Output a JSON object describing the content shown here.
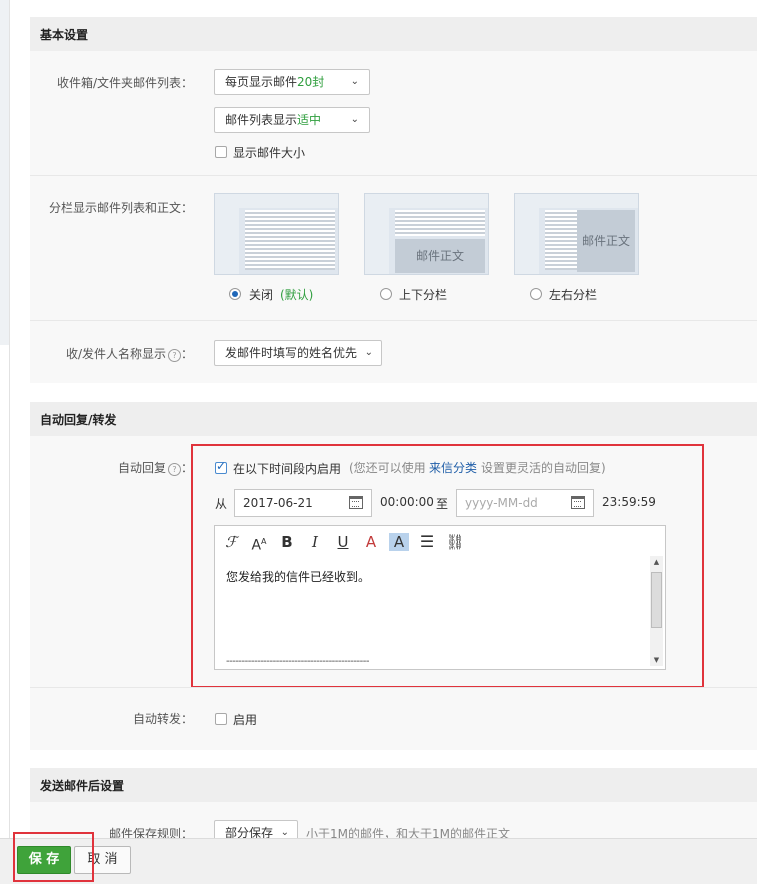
{
  "sections": {
    "basic": "基本设置",
    "auto_reply": "自动回复/转发",
    "after_send": "发送邮件后设置"
  },
  "basic": {
    "mail_list_label": "收件箱/文件夹邮件列表：",
    "per_page_prefix": "每页显示邮件",
    "per_page_value": "20封",
    "list_display_prefix": "邮件列表显示",
    "list_display_value": "适中",
    "show_size_label": "显示邮件大小",
    "show_size_checked": false,
    "split_label": "分栏显示邮件列表和正文：",
    "layout_pane_text": "邮件正文",
    "layouts": [
      {
        "label": "关闭",
        "note": "(默认)",
        "selected": true
      },
      {
        "label": "上下分栏",
        "selected": false
      },
      {
        "label": "左右分栏",
        "selected": false
      }
    ],
    "name_display_label": "收/发件人名称显示",
    "name_display_value": "发邮件时填写的姓名优先"
  },
  "auto_reply": {
    "label": "自动回复",
    "enable_label": "在以下时间段内启用",
    "enable_checked": true,
    "hint_pre": "(您还可以使用",
    "hint_link": "来信分类",
    "hint_post": "设置更灵活的自动回复)",
    "from_label": "从",
    "from_date": "2017-06-21",
    "from_time": "00:00:00",
    "to_label": "至",
    "to_placeholder": "yyyy-MM-dd",
    "to_time": "23:59:59",
    "toolbar": [
      "font-family-icon",
      "font-size-icon",
      "bold-icon",
      "italic-icon",
      "underline-icon",
      "text-color-icon",
      "highlight-icon",
      "align-icon",
      "link-icon"
    ],
    "body_text": "您发给我的信件已经收到。",
    "signature_line": "----------------------------------------------"
  },
  "auto_forward": {
    "label": "自动转发：",
    "enable_label": "启用",
    "enable_checked": false
  },
  "after_send": {
    "save_rule_label": "邮件保存规则：",
    "save_rule_value": "部分保存",
    "save_rule_desc": "小于1M的邮件，和大于1M的邮件正文"
  },
  "buttons": {
    "save": "保 存",
    "cancel": "取 消"
  },
  "colors": {
    "accent_green": "#3fa33a",
    "highlight_red": "#e0333c",
    "link_blue": "#1f5ea8"
  }
}
